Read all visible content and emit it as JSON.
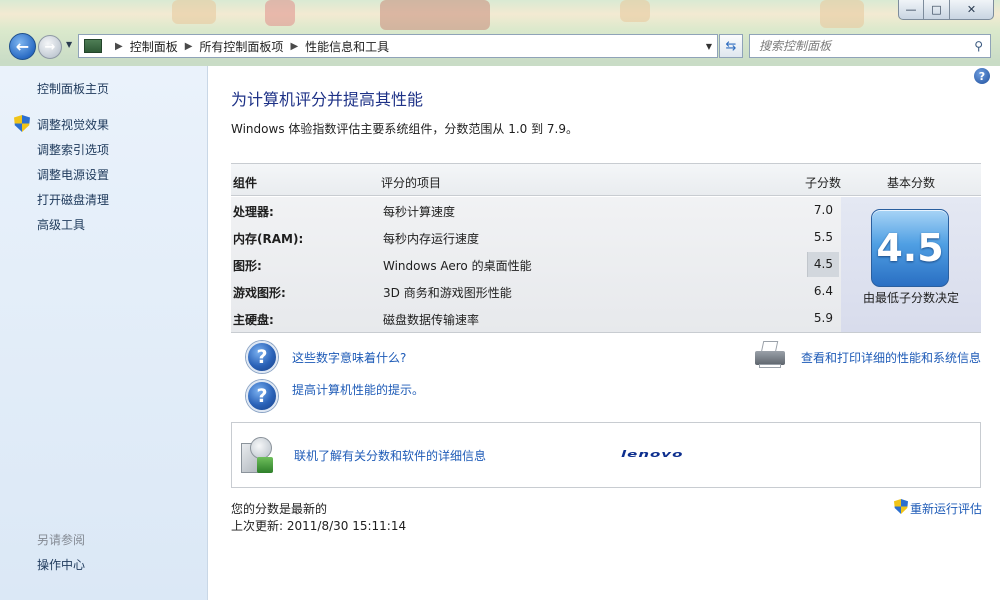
{
  "window": {
    "minimize": "—",
    "maximize": "□",
    "close": "✕"
  },
  "nav": {
    "back_icon": "back-arrow-icon",
    "forward_icon": "forward-arrow-icon",
    "breadcrumbs": [
      "控制面板",
      "所有控制面板项",
      "性能信息和工具"
    ],
    "search_placeholder": "搜索控制面板",
    "colors": {
      "accent": "#2b6cc4"
    }
  },
  "sidebar": {
    "home": "控制面板主页",
    "items": [
      {
        "label": "调整视觉效果",
        "icon": "shield-icon"
      },
      {
        "label": "调整索引选项"
      },
      {
        "label": "调整电源设置"
      },
      {
        "label": "打开磁盘清理"
      },
      {
        "label": "高级工具"
      }
    ],
    "see_also_title": "另请参阅",
    "see_also_items": [
      "操作中心"
    ]
  },
  "main": {
    "title": "为计算机评分并提高其性能",
    "intro": "Windows 体验指数评估主要系统组件，分数范围从 1.0 到 7.9。",
    "table": {
      "headers": [
        "组件",
        "评分的项目",
        "子分数",
        "基本分数"
      ],
      "rows": [
        {
          "component": "处理器:",
          "item": "每秒计算速度",
          "score": "7.0"
        },
        {
          "component": "内存(RAM):",
          "item": "每秒内存运行速度",
          "score": "5.5"
        },
        {
          "component": "图形:",
          "item": "Windows Aero 的桌面性能",
          "score": "4.5"
        },
        {
          "component": "游戏图形:",
          "item": "3D 商务和游戏图形性能",
          "score": "6.4"
        },
        {
          "component": "主硬盘:",
          "item": "磁盘数据传输速率",
          "score": "5.9"
        }
      ],
      "base_score": "4.5",
      "base_caption": "由最低子分数决定"
    },
    "links": {
      "what_numbers_mean": "这些数字意味着什么?",
      "improve_tips": "提高计算机性能的提示。",
      "print_details": "查看和打印详细的性能和系统信息"
    },
    "online": {
      "text": "联机了解有关分数和软件的详细信息",
      "brand": "lenovo"
    },
    "status": {
      "current": "您的分数是最新的",
      "last_update": "上次更新: 2011/8/30 15:11:14",
      "rerun": "重新运行评估"
    }
  }
}
